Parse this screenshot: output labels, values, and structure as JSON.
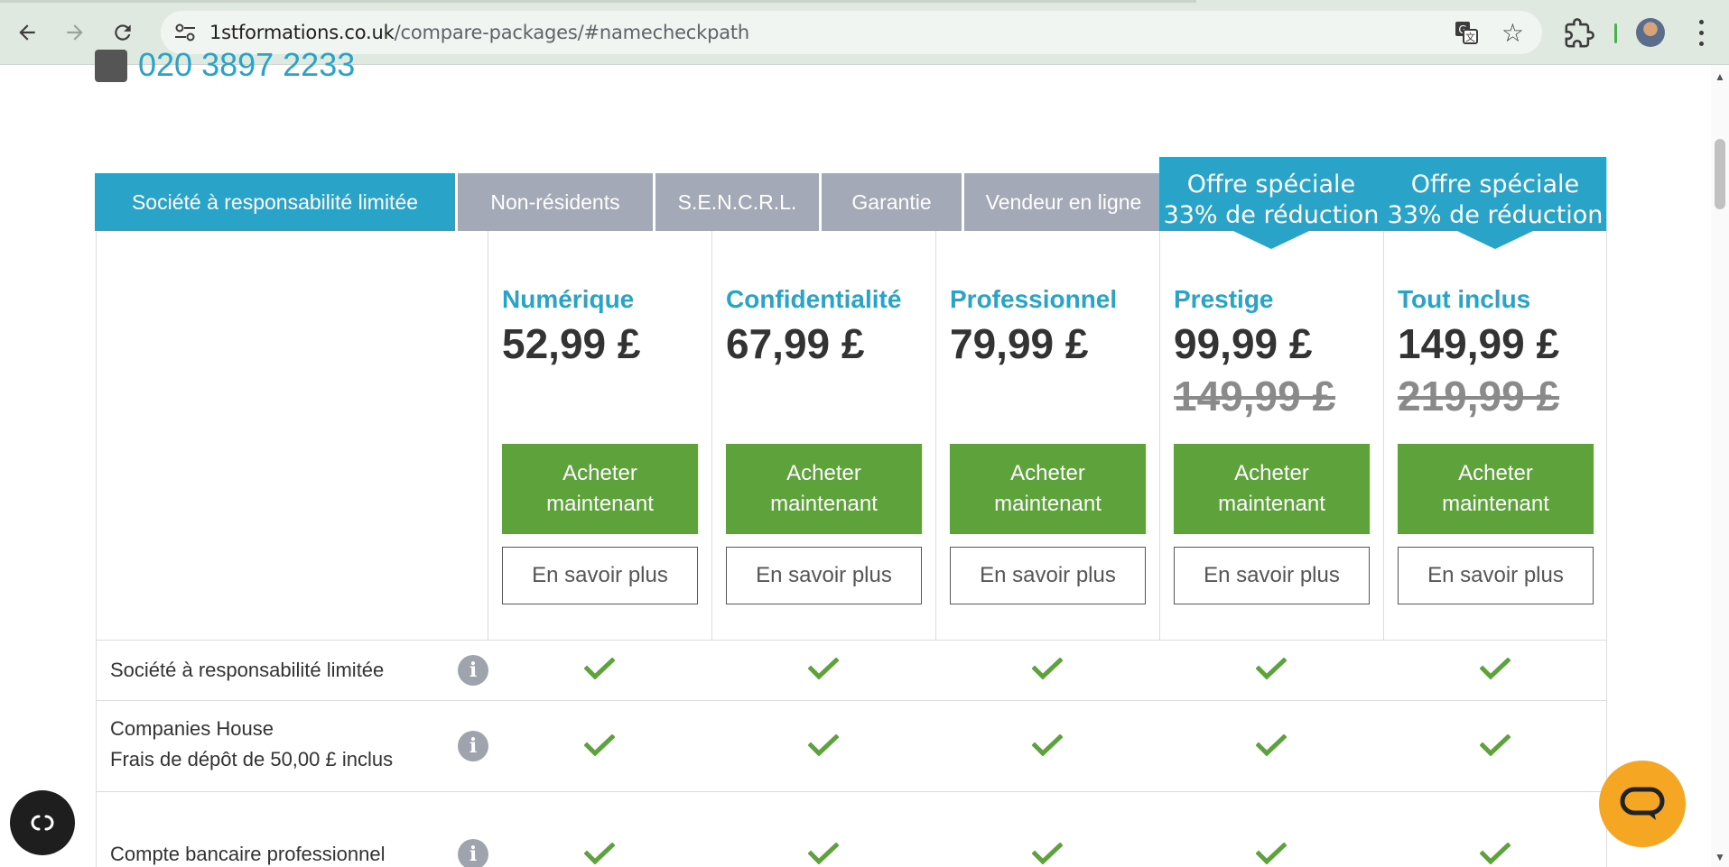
{
  "browser": {
    "url_domain": "1stformations.co.uk",
    "url_path": "/compare-packages/#namecheckpath"
  },
  "header": {
    "phone": "020 3897 2233"
  },
  "tabs": [
    {
      "label": "Société à responsabilité limitée",
      "active": true
    },
    {
      "label": "Non-résidents",
      "active": false
    },
    {
      "label": "S.E.N.C.R.L.",
      "active": false
    },
    {
      "label": "Garantie",
      "active": false
    },
    {
      "label": "Vendeur en ligne",
      "active": false
    }
  ],
  "offers": [
    {
      "line1": "Offre spéciale",
      "line2": "33% de réduction"
    },
    {
      "line1": "Offre spéciale",
      "line2": "33% de réduction"
    }
  ],
  "plans": [
    {
      "name": "Numérique",
      "price": "52,99 £",
      "old_price": ""
    },
    {
      "name": "Confidentialité",
      "price": "67,99 £",
      "old_price": ""
    },
    {
      "name": "Professionnel",
      "price": "79,99 £",
      "old_price": ""
    },
    {
      "name": "Prestige",
      "price": "99,99 £",
      "old_price": "149,99 £"
    },
    {
      "name": "Tout inclus",
      "price": "149,99 £",
      "old_price": "219,99 £"
    }
  ],
  "buttons": {
    "buy_line1": "Acheter",
    "buy_line2": "maintenant",
    "more": "En savoir plus"
  },
  "features": [
    {
      "line1": "Société à responsabilité limitée",
      "line2": "",
      "included": [
        true,
        true,
        true,
        true,
        true
      ]
    },
    {
      "line1": "Companies House",
      "line2": "Frais de dépôt de 50,00 £ inclus",
      "included": [
        true,
        true,
        true,
        true,
        true
      ]
    },
    {
      "line1": "Compte bancaire professionnel",
      "line2": "",
      "included": [
        true,
        true,
        true,
        true,
        true
      ]
    }
  ],
  "icons": {
    "info_glyph": "i"
  },
  "colors": {
    "accent": "#2aa3c9",
    "tab_inactive": "#a3a9b7",
    "buy": "#5da23a",
    "check": "#5da23a",
    "chat": "#f5a623"
  }
}
